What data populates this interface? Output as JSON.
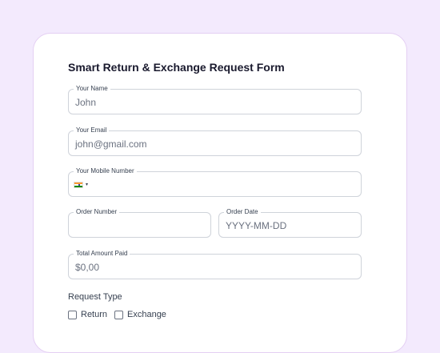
{
  "form": {
    "title": "Smart Return & Exchange Request Form",
    "name": {
      "label": "Your Name",
      "placeholder": "John"
    },
    "email": {
      "label": "Your Email",
      "placeholder": "john@gmail.com"
    },
    "mobile": {
      "label": "Your Mobile Number",
      "country": "India",
      "flag_icon": "india-flag-icon"
    },
    "order_number": {
      "label": "Order Number",
      "placeholder": ""
    },
    "order_date": {
      "label": "Order Date",
      "placeholder": "YYYY-MM-DD"
    },
    "amount": {
      "label": "Total Amount Paid",
      "placeholder": "$0,00"
    },
    "request_type": {
      "label": "Request Type",
      "options": [
        {
          "label": "Return",
          "checked": false
        },
        {
          "label": "Exchange",
          "checked": false
        }
      ]
    }
  },
  "colors": {
    "background": "#f3eafd",
    "card_border": "#e4cff3",
    "field_border": "#cfd3da"
  }
}
